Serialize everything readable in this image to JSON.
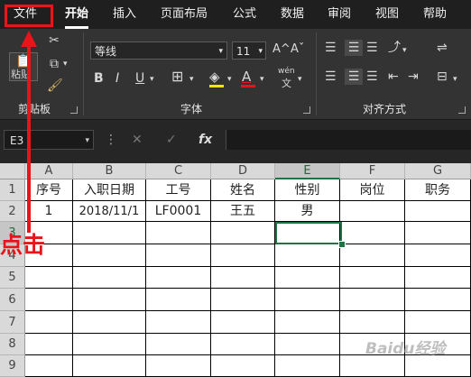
{
  "menu": {
    "file": "文件",
    "tabs": [
      "开始",
      "插入",
      "页面布局",
      "公式",
      "数据",
      "审阅",
      "视图",
      "帮助"
    ]
  },
  "ribbon": {
    "clipboard_label": "剪贴板",
    "paste_label": "粘贴",
    "font_label": "字体",
    "alignment_label": "对齐方式",
    "font_name": "等线",
    "font_size": "11",
    "grow_font": "A^",
    "shrink_font": "Aˇ",
    "bold": "B",
    "italic": "I",
    "underline": "U",
    "phonetic": "wén"
  },
  "formula_bar": {
    "name_box": "E3",
    "fx": "fx",
    "formula": ""
  },
  "grid": {
    "columns": [
      "A",
      "B",
      "C",
      "D",
      "E",
      "F",
      "G"
    ],
    "selected_column": "E",
    "rows": [
      "1",
      "2",
      "3",
      "4",
      "5",
      "6",
      "7",
      "8",
      "9"
    ],
    "selected_row": "3",
    "selected_cell": "E3",
    "headers": [
      "序号",
      "入职日期",
      "工号",
      "姓名",
      "性别",
      "岗位",
      "职务"
    ],
    "row2": [
      "1",
      "2018/11/1",
      "LF0001",
      "王五",
      "男",
      "",
      ""
    ]
  },
  "annotation": {
    "text": "点击",
    "color": "#e8141a"
  },
  "watermark": "Baidu经验",
  "colors": {
    "accent_green": "#217346",
    "annotation_red": "#e8141a"
  }
}
